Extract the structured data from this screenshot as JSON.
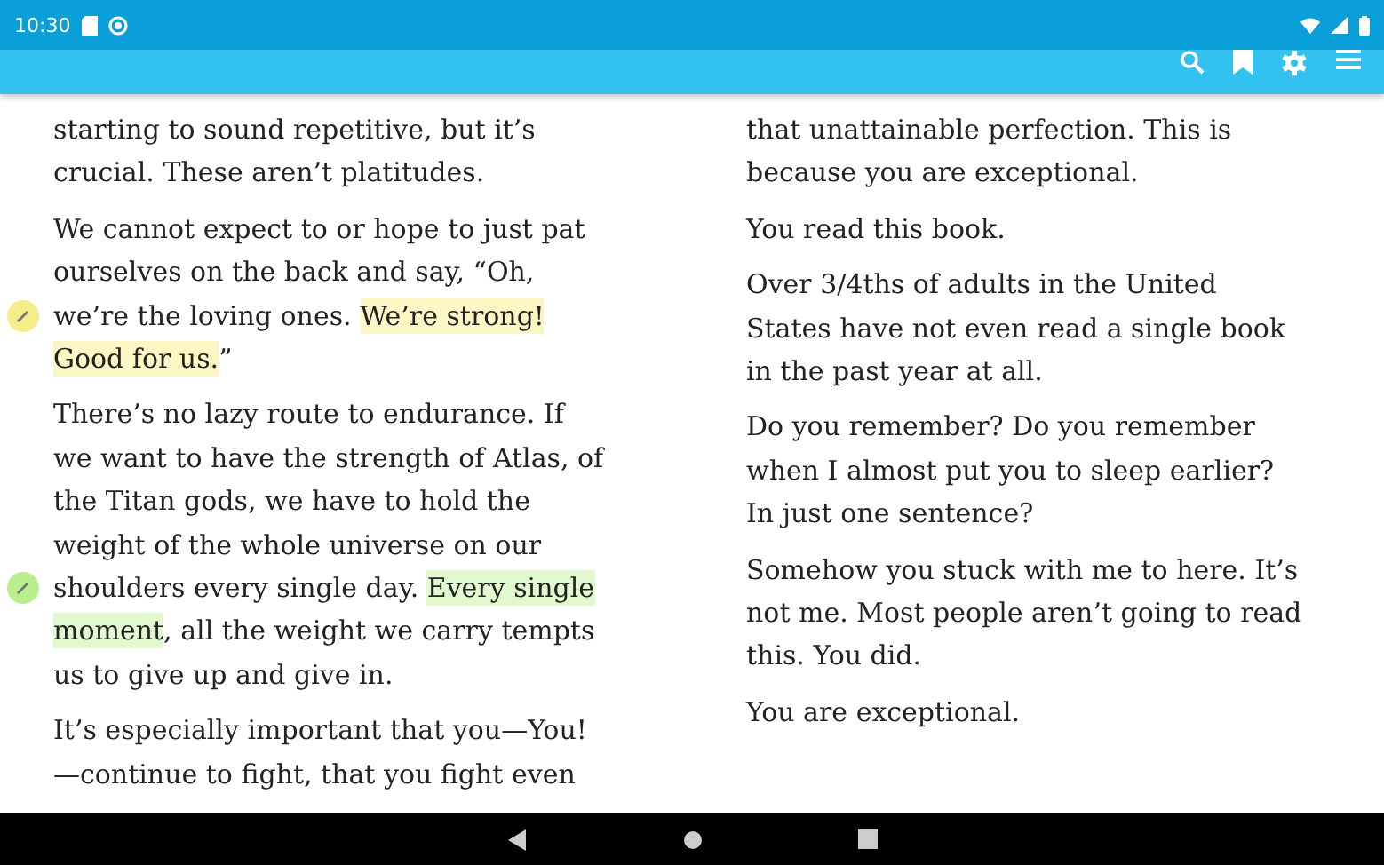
{
  "status_bar": {
    "time": "10:30"
  },
  "columns": [
    {
      "paragraphs": [
        {
          "lines": [
            {
              "segments": [
                {
                  "text": "starting to sound repetitive, but it’s"
                }
              ]
            },
            {
              "segments": [
                {
                  "text": "crucial. These aren’t platitudes."
                }
              ]
            }
          ]
        },
        {
          "lines": [
            {
              "segments": [
                {
                  "text": "We cannot expect to or hope to just pat"
                }
              ]
            },
            {
              "segments": [
                {
                  "text": "ourselves on the back and say, “Oh,"
                }
              ]
            },
            {
              "segments": [
                {
                  "text": "we’re the loving ones. "
                },
                {
                  "text": "We’re strong!",
                  "color": "#fbf6c4"
                }
              ],
              "marker": {
                "color": "#f3ee8a"
              }
            },
            {
              "segments": [
                {
                  "text": "Good for us.",
                  "color": "#fbf6c4"
                },
                {
                  "text": "”"
                }
              ]
            }
          ]
        },
        {
          "lines": [
            {
              "segments": [
                {
                  "text": "There’s no lazy route to endurance. If"
                }
              ]
            },
            {
              "segments": [
                {
                  "text": "we want to have the strength of Atlas, of"
                }
              ]
            },
            {
              "segments": [
                {
                  "text": "the Titan gods, we have to hold the"
                }
              ]
            },
            {
              "segments": [
                {
                  "text": "weight of the whole universe on our"
                }
              ]
            },
            {
              "segments": [
                {
                  "text": "shoulders every single day. "
                },
                {
                  "text": "Every single",
                  "color": "#e2f8cf"
                }
              ],
              "marker": {
                "color": "#b8ee8c"
              }
            },
            {
              "segments": [
                {
                  "text": "moment",
                  "color": "#e2f8cf"
                },
                {
                  "text": ", all the weight we carry tempts"
                }
              ]
            },
            {
              "segments": [
                {
                  "text": "us to give up and give in."
                }
              ]
            }
          ]
        },
        {
          "lines": [
            {
              "segments": [
                {
                  "text": "It’s especially important that you—You!"
                }
              ]
            },
            {
              "segments": [
                {
                  "text": "—continue to fight, that you fight even"
                }
              ]
            }
          ]
        }
      ]
    },
    {
      "paragraphs": [
        {
          "lines": [
            {
              "segments": [
                {
                  "text": "that unattainable perfection. This is"
                }
              ]
            },
            {
              "segments": [
                {
                  "text": "because you are exceptional."
                }
              ]
            }
          ]
        },
        {
          "lines": [
            {
              "segments": [
                {
                  "text": "You read this book."
                }
              ]
            }
          ]
        },
        {
          "lines": [
            {
              "segments": [
                {
                  "text": "Over 3/4ths of adults in the United"
                }
              ]
            },
            {
              "segments": [
                {
                  "text": "States have not even read a single book"
                }
              ]
            },
            {
              "segments": [
                {
                  "text": "in the past year at all."
                }
              ]
            }
          ]
        },
        {
          "lines": [
            {
              "segments": [
                {
                  "text": "Do you remember? Do you remember"
                }
              ]
            },
            {
              "segments": [
                {
                  "text": "when I almost put you to sleep earlier?"
                }
              ]
            },
            {
              "segments": [
                {
                  "text": "In just one sentence?"
                }
              ]
            }
          ]
        },
        {
          "lines": [
            {
              "segments": [
                {
                  "text": "Somehow you stuck with me to here. It’s"
                }
              ]
            },
            {
              "segments": [
                {
                  "text": "not me. Most people aren’t going to read"
                }
              ]
            },
            {
              "segments": [
                {
                  "text": "this. You did."
                }
              ]
            }
          ]
        },
        {
          "lines": [
            {
              "segments": [
                {
                  "text": "You are exceptional."
                }
              ]
            }
          ]
        }
      ]
    }
  ]
}
